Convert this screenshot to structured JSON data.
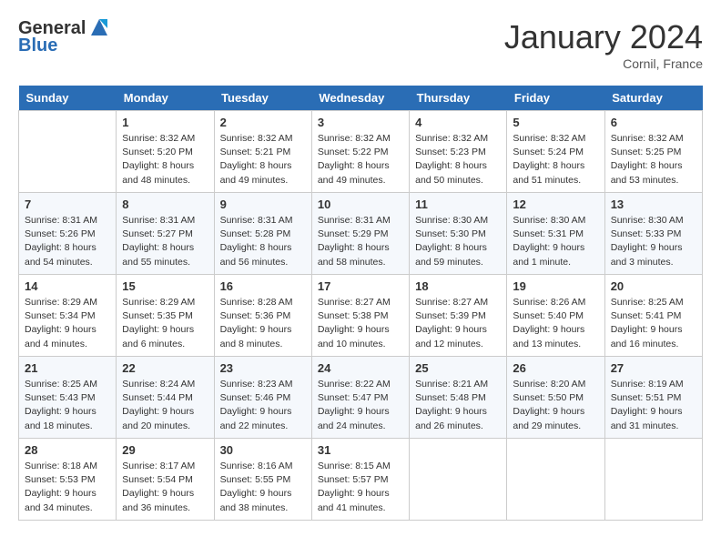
{
  "header": {
    "logo_line1": "General",
    "logo_line2": "Blue",
    "month_title": "January 2024",
    "location": "Cornil, France"
  },
  "days_of_week": [
    "Sunday",
    "Monday",
    "Tuesday",
    "Wednesday",
    "Thursday",
    "Friday",
    "Saturday"
  ],
  "weeks": [
    [
      {
        "day": "",
        "sunrise": "",
        "sunset": "",
        "daylight": ""
      },
      {
        "day": "1",
        "sunrise": "Sunrise: 8:32 AM",
        "sunset": "Sunset: 5:20 PM",
        "daylight": "Daylight: 8 hours and 48 minutes."
      },
      {
        "day": "2",
        "sunrise": "Sunrise: 8:32 AM",
        "sunset": "Sunset: 5:21 PM",
        "daylight": "Daylight: 8 hours and 49 minutes."
      },
      {
        "day": "3",
        "sunrise": "Sunrise: 8:32 AM",
        "sunset": "Sunset: 5:22 PM",
        "daylight": "Daylight: 8 hours and 49 minutes."
      },
      {
        "day": "4",
        "sunrise": "Sunrise: 8:32 AM",
        "sunset": "Sunset: 5:23 PM",
        "daylight": "Daylight: 8 hours and 50 minutes."
      },
      {
        "day": "5",
        "sunrise": "Sunrise: 8:32 AM",
        "sunset": "Sunset: 5:24 PM",
        "daylight": "Daylight: 8 hours and 51 minutes."
      },
      {
        "day": "6",
        "sunrise": "Sunrise: 8:32 AM",
        "sunset": "Sunset: 5:25 PM",
        "daylight": "Daylight: 8 hours and 53 minutes."
      }
    ],
    [
      {
        "day": "7",
        "sunrise": "Sunrise: 8:31 AM",
        "sunset": "Sunset: 5:26 PM",
        "daylight": "Daylight: 8 hours and 54 minutes."
      },
      {
        "day": "8",
        "sunrise": "Sunrise: 8:31 AM",
        "sunset": "Sunset: 5:27 PM",
        "daylight": "Daylight: 8 hours and 55 minutes."
      },
      {
        "day": "9",
        "sunrise": "Sunrise: 8:31 AM",
        "sunset": "Sunset: 5:28 PM",
        "daylight": "Daylight: 8 hours and 56 minutes."
      },
      {
        "day": "10",
        "sunrise": "Sunrise: 8:31 AM",
        "sunset": "Sunset: 5:29 PM",
        "daylight": "Daylight: 8 hours and 58 minutes."
      },
      {
        "day": "11",
        "sunrise": "Sunrise: 8:30 AM",
        "sunset": "Sunset: 5:30 PM",
        "daylight": "Daylight: 8 hours and 59 minutes."
      },
      {
        "day": "12",
        "sunrise": "Sunrise: 8:30 AM",
        "sunset": "Sunset: 5:31 PM",
        "daylight": "Daylight: 9 hours and 1 minute."
      },
      {
        "day": "13",
        "sunrise": "Sunrise: 8:30 AM",
        "sunset": "Sunset: 5:33 PM",
        "daylight": "Daylight: 9 hours and 3 minutes."
      }
    ],
    [
      {
        "day": "14",
        "sunrise": "Sunrise: 8:29 AM",
        "sunset": "Sunset: 5:34 PM",
        "daylight": "Daylight: 9 hours and 4 minutes."
      },
      {
        "day": "15",
        "sunrise": "Sunrise: 8:29 AM",
        "sunset": "Sunset: 5:35 PM",
        "daylight": "Daylight: 9 hours and 6 minutes."
      },
      {
        "day": "16",
        "sunrise": "Sunrise: 8:28 AM",
        "sunset": "Sunset: 5:36 PM",
        "daylight": "Daylight: 9 hours and 8 minutes."
      },
      {
        "day": "17",
        "sunrise": "Sunrise: 8:27 AM",
        "sunset": "Sunset: 5:38 PM",
        "daylight": "Daylight: 9 hours and 10 minutes."
      },
      {
        "day": "18",
        "sunrise": "Sunrise: 8:27 AM",
        "sunset": "Sunset: 5:39 PM",
        "daylight": "Daylight: 9 hours and 12 minutes."
      },
      {
        "day": "19",
        "sunrise": "Sunrise: 8:26 AM",
        "sunset": "Sunset: 5:40 PM",
        "daylight": "Daylight: 9 hours and 13 minutes."
      },
      {
        "day": "20",
        "sunrise": "Sunrise: 8:25 AM",
        "sunset": "Sunset: 5:41 PM",
        "daylight": "Daylight: 9 hours and 16 minutes."
      }
    ],
    [
      {
        "day": "21",
        "sunrise": "Sunrise: 8:25 AM",
        "sunset": "Sunset: 5:43 PM",
        "daylight": "Daylight: 9 hours and 18 minutes."
      },
      {
        "day": "22",
        "sunrise": "Sunrise: 8:24 AM",
        "sunset": "Sunset: 5:44 PM",
        "daylight": "Daylight: 9 hours and 20 minutes."
      },
      {
        "day": "23",
        "sunrise": "Sunrise: 8:23 AM",
        "sunset": "Sunset: 5:46 PM",
        "daylight": "Daylight: 9 hours and 22 minutes."
      },
      {
        "day": "24",
        "sunrise": "Sunrise: 8:22 AM",
        "sunset": "Sunset: 5:47 PM",
        "daylight": "Daylight: 9 hours and 24 minutes."
      },
      {
        "day": "25",
        "sunrise": "Sunrise: 8:21 AM",
        "sunset": "Sunset: 5:48 PM",
        "daylight": "Daylight: 9 hours and 26 minutes."
      },
      {
        "day": "26",
        "sunrise": "Sunrise: 8:20 AM",
        "sunset": "Sunset: 5:50 PM",
        "daylight": "Daylight: 9 hours and 29 minutes."
      },
      {
        "day": "27",
        "sunrise": "Sunrise: 8:19 AM",
        "sunset": "Sunset: 5:51 PM",
        "daylight": "Daylight: 9 hours and 31 minutes."
      }
    ],
    [
      {
        "day": "28",
        "sunrise": "Sunrise: 8:18 AM",
        "sunset": "Sunset: 5:53 PM",
        "daylight": "Daylight: 9 hours and 34 minutes."
      },
      {
        "day": "29",
        "sunrise": "Sunrise: 8:17 AM",
        "sunset": "Sunset: 5:54 PM",
        "daylight": "Daylight: 9 hours and 36 minutes."
      },
      {
        "day": "30",
        "sunrise": "Sunrise: 8:16 AM",
        "sunset": "Sunset: 5:55 PM",
        "daylight": "Daylight: 9 hours and 38 minutes."
      },
      {
        "day": "31",
        "sunrise": "Sunrise: 8:15 AM",
        "sunset": "Sunset: 5:57 PM",
        "daylight": "Daylight: 9 hours and 41 minutes."
      },
      {
        "day": "",
        "sunrise": "",
        "sunset": "",
        "daylight": ""
      },
      {
        "day": "",
        "sunrise": "",
        "sunset": "",
        "daylight": ""
      },
      {
        "day": "",
        "sunrise": "",
        "sunset": "",
        "daylight": ""
      }
    ]
  ]
}
